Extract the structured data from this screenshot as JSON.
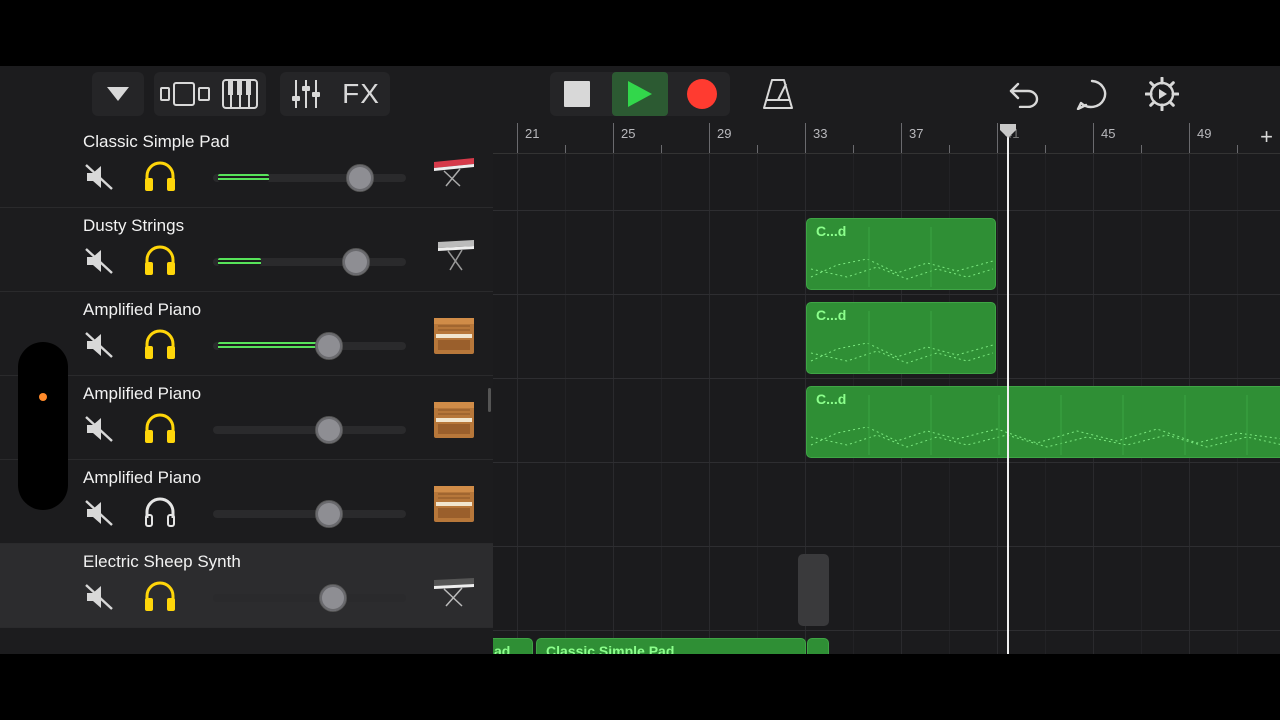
{
  "toolbar": {
    "fx_label": "FX",
    "colors": {
      "play": "#32d74b",
      "record": "#ff3b30",
      "icon": "#d8d8d8"
    }
  },
  "tracks": [
    {
      "name": "Classic Simple Pad",
      "solo_active": true,
      "volume": 0.76,
      "level": 0.26,
      "instrument": "synth-keyboard-red-icon"
    },
    {
      "name": "Dusty Strings",
      "solo_active": true,
      "volume": 0.74,
      "level": 0.22,
      "instrument": "keyboard-stand-icon"
    },
    {
      "name": "Amplified Piano",
      "solo_active": true,
      "volume": 0.6,
      "level": 0.55,
      "instrument": "upright-piano-icon"
    },
    {
      "name": "Amplified Piano",
      "solo_active": true,
      "volume": 0.6,
      "level": 0,
      "instrument": "upright-piano-icon"
    },
    {
      "name": "Amplified Piano",
      "solo_active": false,
      "volume": 0.6,
      "level": 0,
      "instrument": "upright-piano-icon"
    },
    {
      "name": "Electric Sheep Synth",
      "solo_active": true,
      "volume": 0.62,
      "level": 0,
      "instrument": "keyboard-stand-icon",
      "selected": true
    }
  ],
  "ruler": {
    "bars": [
      "21",
      "25",
      "29",
      "33",
      "37",
      "41",
      "45",
      "49"
    ],
    "add_label": "+"
  },
  "regions": {
    "short_label": "C...d",
    "edge_label": "ad",
    "long_label": "Classic Simple Pad"
  },
  "colors": {
    "region": "#2f8f35",
    "region_text": "#8cff8c",
    "solo_on": "#ffd60a",
    "solo_off": "#e5e5e5",
    "meter": "#57e35a"
  }
}
